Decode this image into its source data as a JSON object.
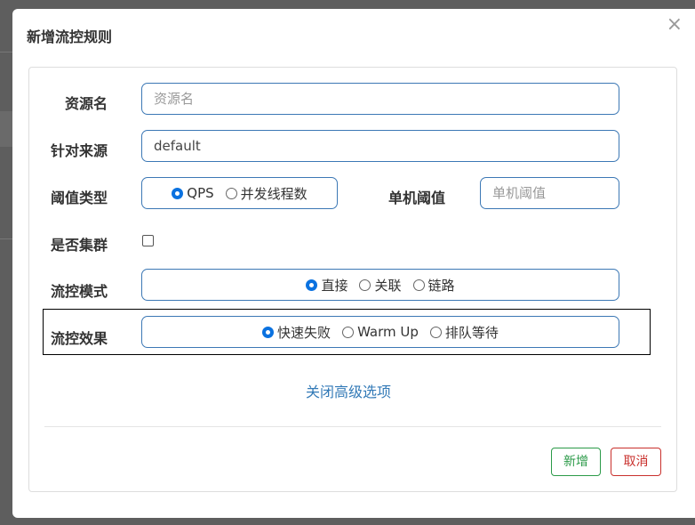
{
  "dialog": {
    "title": "新增流控规则",
    "close": "×"
  },
  "form": {
    "resource_name": {
      "label": "资源名",
      "value": "",
      "placeholder": "资源名"
    },
    "limit_app": {
      "label": "针对来源",
      "value": "default"
    },
    "threshold_type": {
      "label": "阈值类型",
      "options": [
        "QPS",
        "并发线程数"
      ],
      "selected": "QPS"
    },
    "single_threshold": {
      "label": "单机阈值",
      "value": "",
      "placeholder": "单机阈值"
    },
    "cluster": {
      "label": "是否集群",
      "checked": false
    },
    "control_mode": {
      "label": "流控模式",
      "options": [
        "直接",
        "关联",
        "链路"
      ],
      "selected": "直接"
    },
    "control_effect": {
      "label": "流控效果",
      "options": [
        "快速失败",
        "Warm Up",
        "排队等待"
      ],
      "selected": "快速失败"
    },
    "advanced_toggle": "关闭高级选项"
  },
  "footer": {
    "add_label": "新增",
    "cancel_label": "取消"
  },
  "colors": {
    "accent": "#3c78b5",
    "radio_checked": "#0b72e0",
    "add": "#2b9a48",
    "cancel": "#c9302c",
    "link": "#337ab7"
  }
}
